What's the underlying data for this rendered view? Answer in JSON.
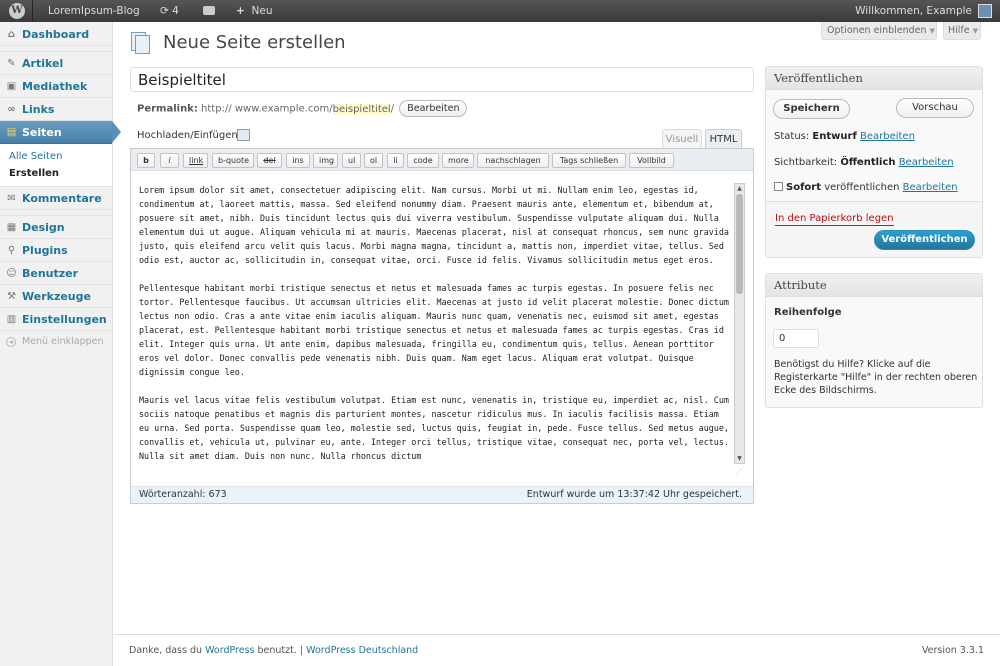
{
  "adminbar": {
    "site_name": "LoremIpsum-Blog",
    "updates_count": "4",
    "new_label": "Neu",
    "welcome": "Willkommen, Example"
  },
  "sidebar": {
    "items": [
      {
        "label": "Dashboard",
        "icon": "house-icon"
      },
      {
        "label": "Artikel",
        "icon": "pin-icon"
      },
      {
        "label": "Mediathek",
        "icon": "media-icon"
      },
      {
        "label": "Links",
        "icon": "link-icon"
      },
      {
        "label": "Seiten",
        "icon": "pages-icon"
      },
      {
        "label": "Kommentare",
        "icon": "comments-icon"
      },
      {
        "label": "Design",
        "icon": "appearance-icon"
      },
      {
        "label": "Plugins",
        "icon": "plugin-icon"
      },
      {
        "label": "Benutzer",
        "icon": "users-icon"
      },
      {
        "label": "Werkzeuge",
        "icon": "tools-icon"
      },
      {
        "label": "Einstellungen",
        "icon": "settings-icon"
      }
    ],
    "submenu": [
      "Alle Seiten",
      "Erstellen"
    ],
    "collapse": "Menü einklappen"
  },
  "header": {
    "title": "Neue Seite erstellen",
    "screen_options": "Optionen einblenden",
    "help": "Hilfe"
  },
  "post": {
    "title": "Beispieltitel",
    "permalink_label": "Permalink:",
    "permalink_base": "http:// www.example.com/",
    "permalink_slug": "beispieltitel",
    "permalink_trail": "/",
    "permalink_edit": "Bearbeiten"
  },
  "editor": {
    "upload_label": "Hochladen/Einfügen",
    "tab_visual": "Visuell",
    "tab_html": "HTML",
    "buttons": [
      "b",
      "i",
      "link",
      "b-quote",
      "del",
      "ins",
      "img",
      "ul",
      "ol",
      "li",
      "code",
      "more",
      "nachschlagen",
      "Tags schließen",
      "Vollbild"
    ],
    "paragraphs": [
      "Lorem ipsum dolor sit amet, consectetuer adipiscing elit. Nam cursus. Morbi ut mi. Nullam enim leo, egestas id, condimentum at, laoreet mattis, massa. Sed eleifend nonummy diam. Praesent mauris ante, elementum et, bibendum at, posuere sit amet, nibh. Duis tincidunt lectus quis dui viverra vestibulum. Suspendisse vulputate aliquam dui. Nulla elementum dui ut augue. Aliquam vehicula mi at mauris. Maecenas placerat, nisl at consequat rhoncus, sem nunc gravida justo, quis eleifend arcu velit quis lacus. Morbi magna magna, tincidunt a, mattis non, imperdiet vitae, tellus. Sed odio est, auctor ac, sollicitudin in, consequat vitae, orci. Fusce id felis. Vivamus sollicitudin metus eget eros.",
      "Pellentesque habitant morbi tristique senectus et netus et malesuada fames ac turpis egestas. In posuere felis nec tortor. Pellentesque faucibus. Ut accumsan ultricies elit. Maecenas at justo id velit placerat molestie. Donec dictum lectus non odio. Cras a ante vitae enim iaculis aliquam. Mauris nunc quam, venenatis nec, euismod sit amet, egestas placerat, est. Pellentesque habitant morbi tristique senectus et netus et malesuada fames ac turpis egestas. Cras id elit. Integer quis urna. Ut ante enim, dapibus malesuada, fringilla eu, condimentum quis, tellus. Aenean porttitor eros vel dolor. Donec convallis pede venenatis nibh. Duis quam. Nam eget lacus. Aliquam erat volutpat. Quisque dignissim congue leo.",
      "Mauris vel lacus vitae felis vestibulum volutpat. Etiam est nunc, venenatis in, tristique eu, imperdiet ac, nisl. Cum sociis natoque penatibus et magnis dis parturient montes, nascetur ridiculus mus. In iaculis facilisis massa. Etiam eu urna. Sed porta. Suspendisse quam leo, molestie sed, luctus quis, feugiat in, pede. Fusce tellus. Sed metus augue, convallis et, vehicula ut, pulvinar eu, ante. Integer orci tellus, tristique vitae, consequat nec, porta vel, lectus. Nulla sit amet diam. Duis non nunc. Nulla rhoncus dictum"
    ],
    "word_count": "Wörteranzahl: 673",
    "draft_saved": "Entwurf wurde um 13:37:42 Uhr gespeichert."
  },
  "publish": {
    "title": "Veröffentlichen",
    "save": "Speichern",
    "preview": "Vorschau",
    "status_label": "Status:",
    "status_value": "Entwurf",
    "visibility_label": "Sichtbarkeit:",
    "visibility_value": "Öffentlich",
    "schedule_value": "Sofort",
    "schedule_label": "veröffentlichen",
    "edit": "Bearbeiten",
    "trash": "In den Papierkorb legen",
    "publish": "Veröffentlichen"
  },
  "attributes": {
    "title": "Attribute",
    "order_label": "Reihenfolge",
    "order_value": "0",
    "help": "Benötigst du Hilfe? Klicke auf die Registerkarte \"Hilfe\" in der rechten oberen Ecke des Bildschirms."
  },
  "footer": {
    "thanks_pre": "Danke, dass du",
    "thanks_link": "WordPress",
    "thanks_post": "benutzt.",
    "separator": "|",
    "community_link": "WordPress Deutschland",
    "version": "Version 3.3.1"
  }
}
